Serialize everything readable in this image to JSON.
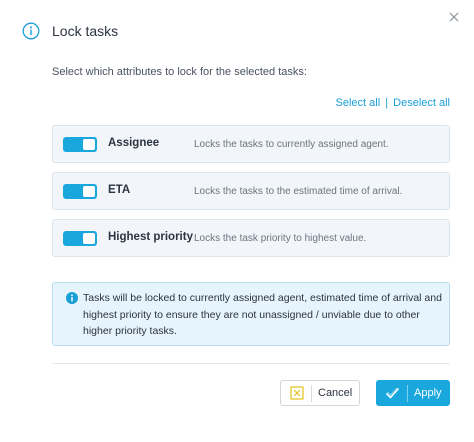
{
  "dialog": {
    "title": "Lock tasks",
    "title_icon": "info-icon",
    "close_icon": "close-icon",
    "subtitle": "Select which attributes to lock for the selected tasks:",
    "select_all": "Select all",
    "separator": "|",
    "deselect_all": "Deselect all"
  },
  "attributes": [
    {
      "name": "Assignee",
      "description": "Locks the tasks to currently assigned agent.",
      "enabled": true
    },
    {
      "name": "ETA",
      "description": "Locks the tasks to the estimated time of arrival.",
      "enabled": true
    },
    {
      "name": "Highest priority",
      "description": "Locks the task priority to highest value.",
      "enabled": true
    }
  ],
  "info": {
    "icon": "info-icon",
    "text": "Tasks will be locked to currently assigned agent, estimated time of arrival and highest priority to ensure they are not unassigned / unviable due to other higher priority tasks."
  },
  "buttons": {
    "cancel_label": "Cancel",
    "cancel_icon": "cancel-icon",
    "apply_label": "Apply",
    "apply_icon": "checkmark-icon"
  },
  "colors": {
    "accent": "#1aa7de",
    "info_bg": "#e6f4fb",
    "row_bg": "#f2f6fa",
    "cancel_icon": "#e6c21a"
  }
}
